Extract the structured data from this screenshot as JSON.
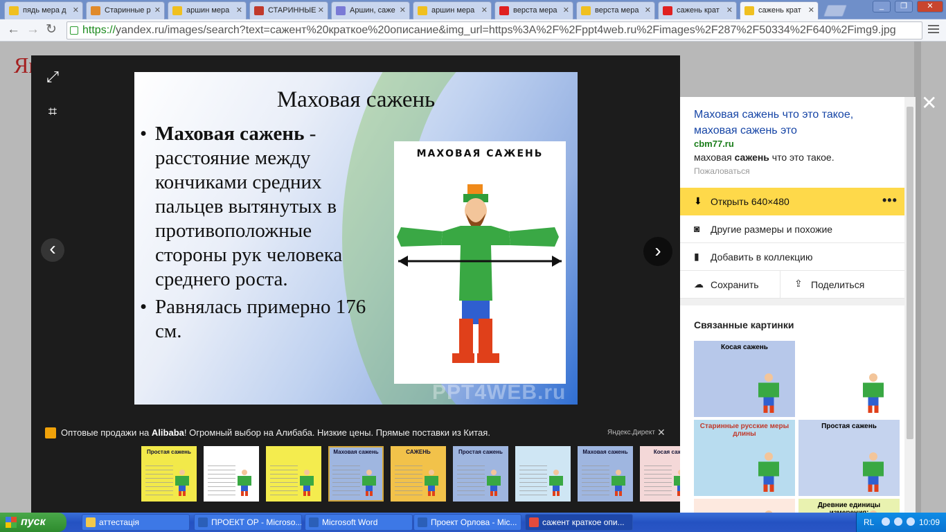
{
  "browser": {
    "tabs": [
      {
        "label": "пядь мера д",
        "icon": "yandex-images-icon",
        "color": "#f0c020"
      },
      {
        "label": "Старинные р",
        "icon": "page-icon",
        "color": "#e08a2a"
      },
      {
        "label": "аршин мера",
        "icon": "yandex-images-icon",
        "color": "#f0c020"
      },
      {
        "label": "СТАРИННЫЕ",
        "icon": "page-icon",
        "color": "#c0392b"
      },
      {
        "label": "Аршин, саже",
        "icon": "user-icon",
        "color": "#7a7ad6"
      },
      {
        "label": "аршин мера",
        "icon": "yandex-images-icon",
        "color": "#f0c020"
      },
      {
        "label": "верста мера",
        "icon": "yandex-icon",
        "color": "#e02020"
      },
      {
        "label": "верста мера",
        "icon": "yandex-images-icon",
        "color": "#f0c020"
      },
      {
        "label": "сажень крат",
        "icon": "yandex-icon",
        "color": "#e02020"
      },
      {
        "label": "сажень крат",
        "icon": "yandex-images-icon",
        "color": "#f0c020"
      }
    ],
    "active_tab": 9,
    "url_scheme": "https://",
    "url_rest": "yandex.ru/images/search?text=сажент%20краткое%20описание&img_url=https%3A%2F%2Fppt4web.ru%2Fimages%2F287%2F50334%2F640%2Fimg9.jpg"
  },
  "page": {
    "logo": "Ян"
  },
  "viewer": {
    "slide": {
      "title": "Маховая сажень",
      "bullet1_bold": "Маховая сажень",
      "bullet1_rest": " - расстояние между кончиками средних пальцев вытянутых в противоположные стороны рук человека среднего роста.",
      "bullet2": "Равнялась примерно 176 см.",
      "figure_caption": "МАХОВАЯ САЖЕНЬ",
      "watermark": "PPT4WEB.ru"
    },
    "ad": {
      "brand": "Alibaba",
      "prefix": "Оптовые продажи на ",
      "rest": "! Огромный выбор на Алибаба. Низкие цены. Прямые поставки из Китая.",
      "direct": "Яндекс.Директ"
    },
    "thumbs": [
      {
        "cap": "Простая сажень",
        "color": "#f2e94a"
      },
      {
        "cap": "",
        "color": "#ffffff"
      },
      {
        "cap": "",
        "color": "#f4ec4e"
      },
      {
        "cap": "Маховая сажень",
        "color": "#9fb6e0"
      },
      {
        "cap": "САЖЕНЬ",
        "color": "#f2c24a"
      },
      {
        "cap": "Простая сажень",
        "color": "#9fb6e0"
      },
      {
        "cap": "",
        "color": "#cfe6f4"
      },
      {
        "cap": "Маховая сажень",
        "color": "#9fb6e0"
      },
      {
        "cap": "Косая саж",
        "color": "#f4d8d8"
      }
    ],
    "selected_thumb": 3
  },
  "panel": {
    "title": "Маховая сажень что это такое, маховая сажень это",
    "site": "cbm77.ru",
    "desc_pre": "маховая ",
    "desc_bold": "сажень",
    "desc_post": " что это такое.",
    "complain": "Пожаловаться",
    "open_label": "Открыть  640×480",
    "other_sizes": "Другие размеры и похожие",
    "add_collection": "Добавить в коллекцию",
    "save": "Сохранить",
    "share": "Поделиться",
    "related_title": "Связанные картинки",
    "related": [
      {
        "cap": "Косая сажень",
        "color": "#b7c8ea"
      },
      {
        "cap": "",
        "color": "#ffffff"
      },
      {
        "cap": "Старинные русские меры длины",
        "color": "#b8dcef"
      },
      {
        "cap": "Простая сажень",
        "color": "#c5d3ee"
      },
      {
        "cap": "",
        "color": "#fde9df"
      },
      {
        "cap": "Древние единицы измерения:",
        "color": "#e9f2b0"
      }
    ]
  },
  "taskbar": {
    "start": "пуск",
    "items": [
      {
        "label": "аттестація",
        "icon": "folder-icon",
        "color": "#f2c94c"
      },
      {
        "label": "ПРОЕКТ ОР - Microso...",
        "icon": "word-icon",
        "color": "#2b5fb8"
      },
      {
        "label": "Microsoft Word",
        "icon": "word-icon",
        "color": "#2b5fb8"
      },
      {
        "label": "Проект Орлова - Mic...",
        "icon": "word-icon",
        "color": "#2b5fb8"
      },
      {
        "label": "сажент краткое опи...",
        "icon": "chrome-icon",
        "color": "#e44b3c"
      }
    ],
    "active_item": 4,
    "lang": "RL",
    "clock": "10:09"
  }
}
